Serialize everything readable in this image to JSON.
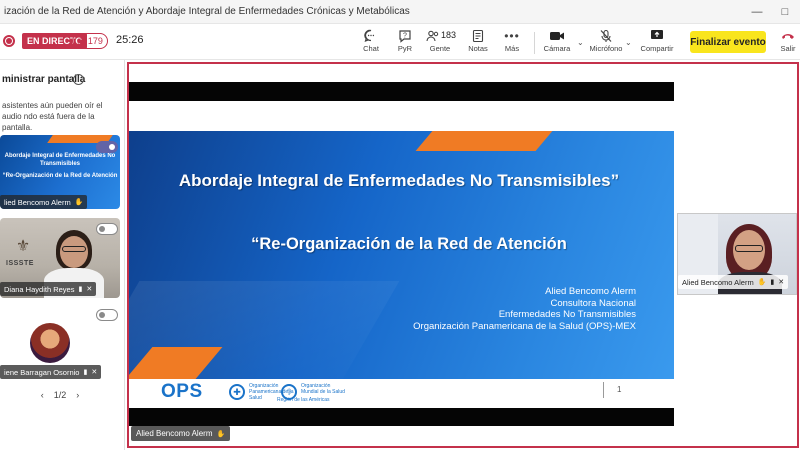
{
  "window": {
    "title": "ización de la Red de Atención y Abordaje Integral de Enfermedades Crónicas y Metabólicas",
    "controls": [
      "—",
      "□"
    ]
  },
  "toolbar": {
    "live_label": "EN DIRECTO",
    "viewer_count": "179",
    "timer": "25:26",
    "chat_label": "Chat",
    "qa_label": "PyR",
    "people_label": "Gente",
    "people_count": "183",
    "notes_label": "Notas",
    "more_label": "Más",
    "camera_label": "Cámara",
    "mic_label": "Micrófono",
    "share_label": "Compartir",
    "end_event_label": "Finalizar evento",
    "leave_label": "Salir",
    "colors": {
      "live": "#c4314b",
      "end_button": "#f9e51d",
      "accent": "#6264a7"
    }
  },
  "left_panel": {
    "title": "ministrar pantalla",
    "info_icon": "info-icon",
    "note": "asistentes aún pueden oír el audio ndo está fuera de la pantalla.",
    "thumbnails": [
      {
        "kind": "slide",
        "line1": "Abordaje Integral de Enfermedades No",
        "line2": "Transmisibles",
        "line3": "“Re-Organización de la Red de Atención",
        "name": "lied Bencomo Alerm",
        "toggle_on": true
      },
      {
        "kind": "camera",
        "logo_text": "ISSSTE",
        "name": "Diana Haydith Reyes",
        "toggle_on": false
      },
      {
        "kind": "avatar",
        "name": "iene Barragan Osornio",
        "toggle_on": false
      }
    ],
    "pager": {
      "prev": "‹",
      "label": "1/2",
      "next": "›"
    }
  },
  "slide": {
    "title": "Abordaje Integral de Enfermedades No Transmisibles”",
    "subtitle": "“Re-Organización de la Red de Atención",
    "author_lines": [
      "Alied Bencomo Alerm",
      "Consultora Nacional",
      "Enfermedades No Transmisibles",
      "Organización Panamericana de la Salud (OPS)-MEX"
    ],
    "ops_logo": "OPS",
    "paho_text": "Organización Panamericana de la Salud",
    "who_text": "Organización Mundial de la Salud",
    "who_subtext": "Región de las Américas",
    "page_number": "1",
    "colors": {
      "blue": "#1565c8",
      "orange": "#f07b24"
    }
  },
  "stage": {
    "presenter_name": "Alied Bencomo Alerm",
    "camera_tile_name": "Alied Bencomo Alerm"
  }
}
